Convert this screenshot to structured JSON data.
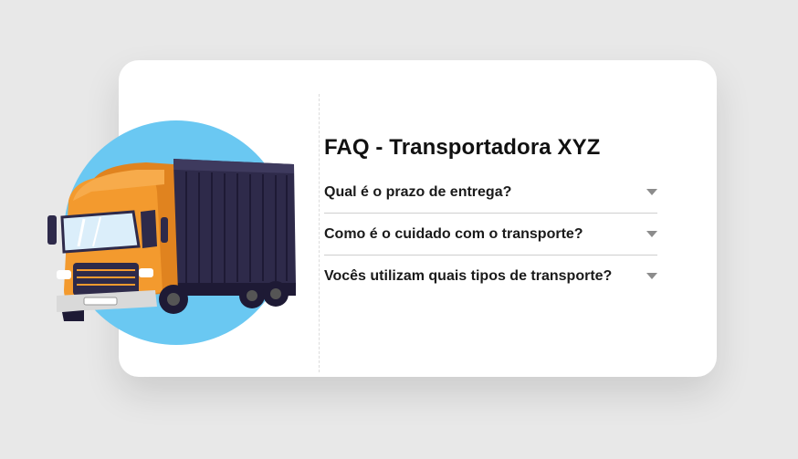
{
  "faq": {
    "title": "FAQ - Transportadora XYZ",
    "items": [
      {
        "question": "Qual é o prazo de entrega?"
      },
      {
        "question": "Como é o cuidado com o transporte?"
      },
      {
        "question": "Vocês utilizam quais tipos de transporte?"
      }
    ]
  },
  "illustration": {
    "subject": "truck-icon"
  },
  "colors": {
    "background": "#e8e8e8",
    "card": "#ffffff",
    "circle": "#6ac8f2",
    "truck_cab": "#f39a2e",
    "truck_trailer": "#2e2a4a",
    "caret": "#8c8c8c"
  }
}
